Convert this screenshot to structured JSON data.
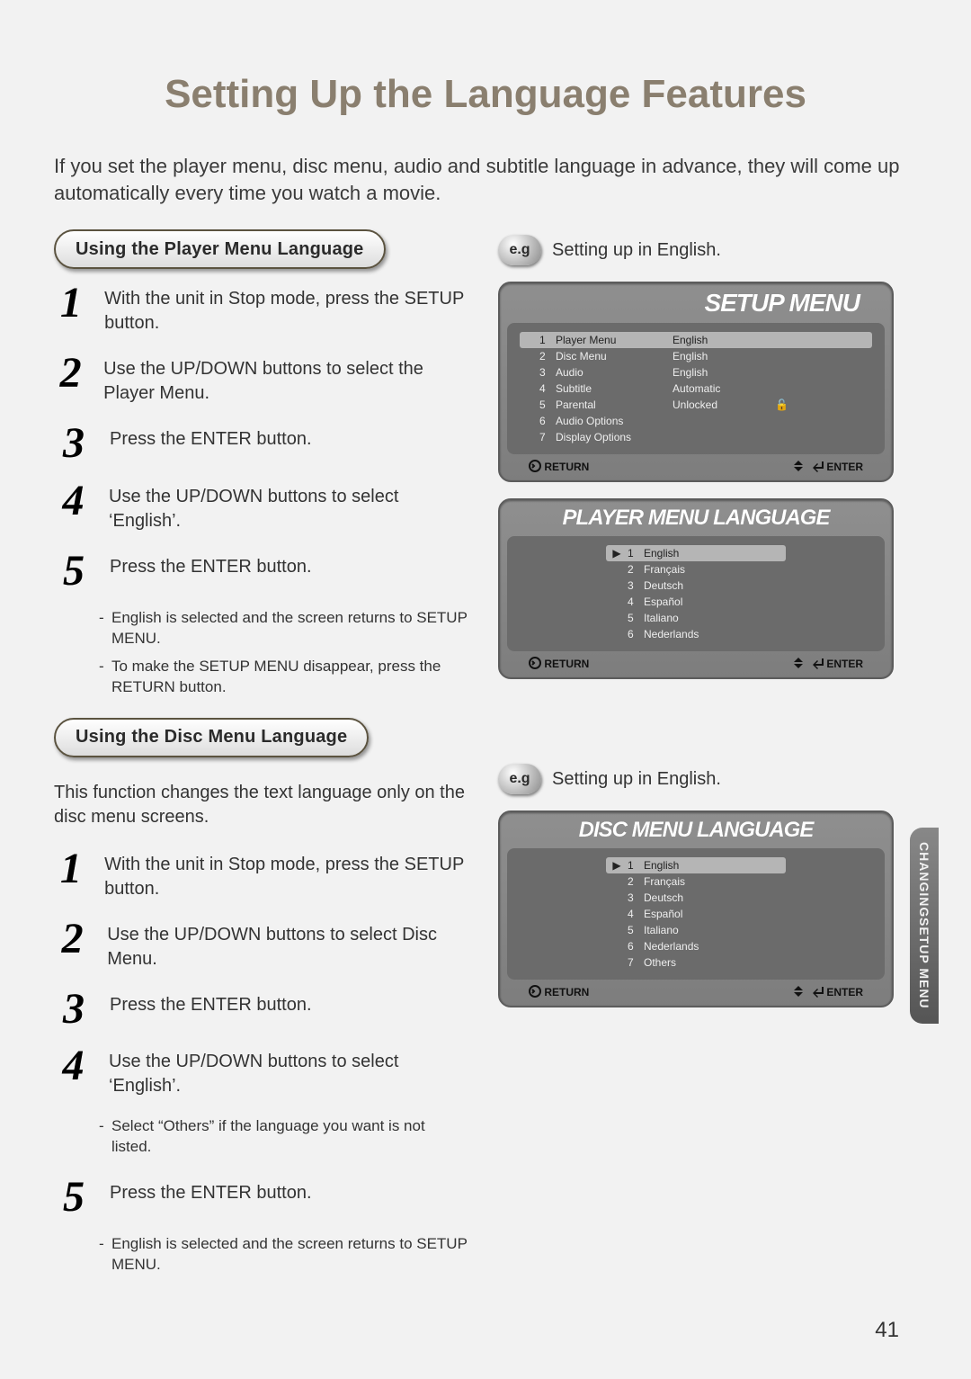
{
  "title": "Setting Up the Language Features",
  "intro": "If you set the player menu, disc menu, audio and subtitle language in advance, they will come up automatically every time you watch a movie.",
  "page_number": "41",
  "side_tab": {
    "line1": "CHANGING",
    "line2": "SETUP MENU"
  },
  "section1": {
    "heading": "Using the Player Menu Language",
    "steps": [
      "With the unit in Stop mode, press the SETUP button.",
      "Use the UP/DOWN buttons to select the Player Menu.",
      "Press the ENTER button.",
      "Use the UP/DOWN buttons to select ‘English’.",
      "Press the ENTER button."
    ],
    "notes": [
      "English is selected and the screen returns to SETUP MENU.",
      "To make the SETUP MENU disappear, press the RETURN button."
    ]
  },
  "section2": {
    "heading": "Using the Disc Menu Language",
    "description": "This function changes the text language only on the disc menu screens.",
    "steps": [
      "With the unit in Stop mode, press the SETUP button.",
      "Use the UP/DOWN buttons to select Disc Menu.",
      "Press the ENTER button.",
      "Use the UP/DOWN buttons to select ‘English’.",
      "Press the ENTER button."
    ],
    "notes_after4": [
      "Select “Others” if the language you want is not listed."
    ],
    "notes_after5": [
      "English is selected and the screen returns to SETUP MENU."
    ]
  },
  "example": {
    "badge": "e.g",
    "text": "Setting up in English."
  },
  "osd_setup": {
    "header": "SETUP MENU",
    "items": [
      {
        "n": "1",
        "label": "Player Menu",
        "value": "English",
        "lock": false,
        "selected": true
      },
      {
        "n": "2",
        "label": "Disc Menu",
        "value": "English",
        "lock": false,
        "selected": false
      },
      {
        "n": "3",
        "label": "Audio",
        "value": "English",
        "lock": false,
        "selected": false
      },
      {
        "n": "4",
        "label": "Subtitle",
        "value": "Automatic",
        "lock": false,
        "selected": false
      },
      {
        "n": "5",
        "label": "Parental",
        "value": "Unlocked",
        "lock": true,
        "selected": false
      },
      {
        "n": "6",
        "label": "Audio Options",
        "value": "",
        "lock": false,
        "selected": false
      },
      {
        "n": "7",
        "label": "Display Options",
        "value": "",
        "lock": false,
        "selected": false
      }
    ],
    "foot_left": "RETURN",
    "foot_right": "ENTER"
  },
  "osd_player_lang": {
    "header": "PLAYER MENU LANGUAGE",
    "items": [
      {
        "n": "1",
        "label": "English",
        "selected": true
      },
      {
        "n": "2",
        "label": "Français",
        "selected": false
      },
      {
        "n": "3",
        "label": "Deutsch",
        "selected": false
      },
      {
        "n": "4",
        "label": "Español",
        "selected": false
      },
      {
        "n": "5",
        "label": "Italiano",
        "selected": false
      },
      {
        "n": "6",
        "label": "Nederlands",
        "selected": false
      }
    ],
    "foot_left": "RETURN",
    "foot_right": "ENTER"
  },
  "osd_disc_lang": {
    "header": "DISC MENU LANGUAGE",
    "items": [
      {
        "n": "1",
        "label": "English",
        "selected": true
      },
      {
        "n": "2",
        "label": "Français",
        "selected": false
      },
      {
        "n": "3",
        "label": "Deutsch",
        "selected": false
      },
      {
        "n": "4",
        "label": "Español",
        "selected": false
      },
      {
        "n": "5",
        "label": "Italiano",
        "selected": false
      },
      {
        "n": "6",
        "label": "Nederlands",
        "selected": false
      },
      {
        "n": "7",
        "label": "Others",
        "selected": false
      }
    ],
    "foot_left": "RETURN",
    "foot_right": "ENTER"
  }
}
